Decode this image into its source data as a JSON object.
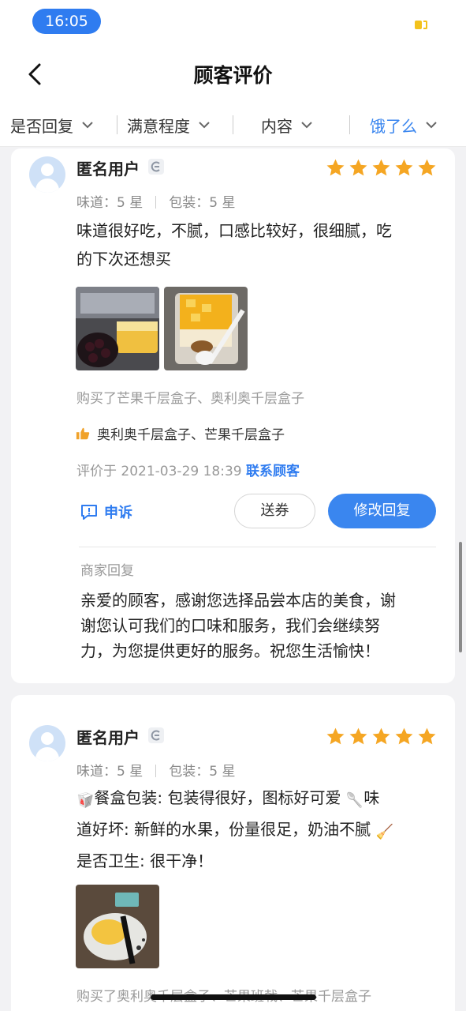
{
  "status": {
    "time": "16:05"
  },
  "header": {
    "title": "顾客评价"
  },
  "filters": [
    {
      "label": "是否回复"
    },
    {
      "label": "满意程度"
    },
    {
      "label": "内容"
    },
    {
      "label": "饿了么"
    }
  ],
  "colors": {
    "accent": "#3a86ef",
    "star": "#f5a623"
  },
  "reviews": [
    {
      "user": "匿名用户",
      "stars": 5,
      "ratings": {
        "taste": "味道：5 星",
        "packaging": "包装：5 星"
      },
      "text_lines": [
        "味道很好吃，不腻，口感比较好，很细腻，吃",
        "的下次还想买"
      ],
      "photos": [
        "photo-cheesecake-cherries",
        "photo-mango-dessert-spoon"
      ],
      "bought": "购买了芒果千层盒子、奥利奥千层盒子",
      "liked": "奥利奥千层盒子、芒果千层盒子",
      "date": "评价于 2021-03-29 18:39",
      "contact": "联系顾客",
      "complaint": "申诉",
      "coupon": "送券",
      "edit_reply": "修改回复",
      "reply_label": "商家回复",
      "reply_lines": [
        "亲爱的顾客，感谢您选择品尝本店的美食，谢",
        "谢您认可我们的口味和服务，我们会继续努",
        "力，为您提供更好的服务。祝您生活愉快！"
      ]
    },
    {
      "user": "匿名用户",
      "stars": 5,
      "ratings": {
        "taste": "味道：5 星",
        "packaging": "包装：5 星"
      },
      "line1_a": "餐盒包装: 包装得很好，图标好可爱",
      "line1_b": "味",
      "line2_a": "道好坏: 新鲜的水果，份量很足，奶油不腻",
      "line3": "是否卫生: 很干净！",
      "photos": [
        "photo-mango-box-spoon"
      ],
      "bought": "购买了奥利奥千层盒子、芒果班戟、芒果千层盒子"
    }
  ]
}
